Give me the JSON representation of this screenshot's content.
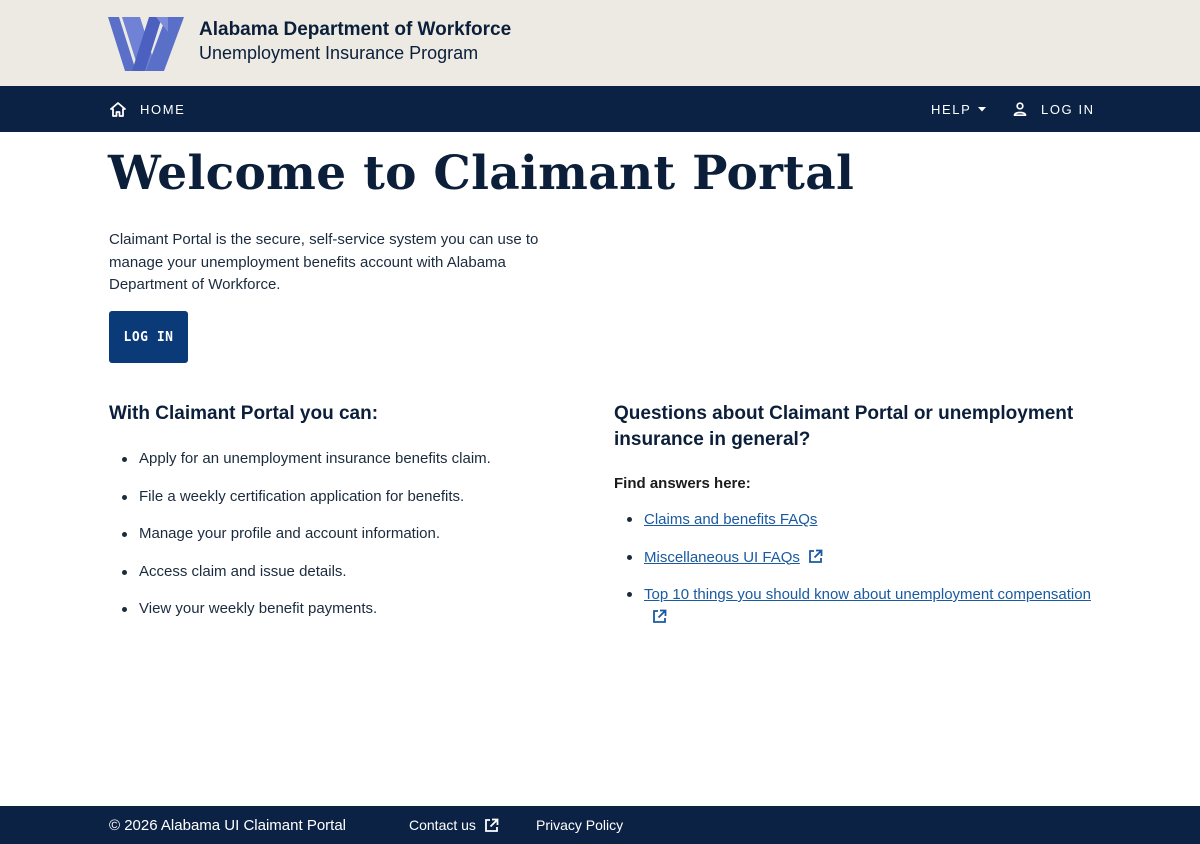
{
  "header": {
    "org_name": "Alabama Department of Workforce",
    "program_name": "Unemployment Insurance Program",
    "logo_icon": "adw-logo-icon",
    "logo_color": "#5a6fc8"
  },
  "nav": {
    "home_label": "HOME",
    "help_label": "HELP",
    "login_label": "LOG IN",
    "home_icon": "home-icon",
    "user_icon": "user-icon"
  },
  "main": {
    "title": "Welcome to Claimant Portal",
    "intro": "Claimant Portal is the secure, self-service system you can use to manage your unemployment benefits account with Alabama Department of Workforce.",
    "login_button": "LOG IN"
  },
  "features": {
    "heading": "With Claimant Portal you can:",
    "items": [
      "Apply for an unemployment insurance benefits claim.",
      "File a weekly certification application for benefits.",
      "Manage your profile and account information.",
      "Access claim and issue details.",
      "View your weekly benefit payments."
    ]
  },
  "questions": {
    "heading": "Questions about Claimant Portal or unemployment insurance in general?",
    "find_answers": "Find answers here:",
    "links": [
      "Claims and benefits FAQs",
      "Miscellaneous UI FAQs",
      "Top 10 things you should know about unemployment compensation"
    ]
  },
  "footer": {
    "copyright": "© 2026  Alabama UI Claimant Portal",
    "contact": "Contact us",
    "privacy": "Privacy Policy"
  },
  "colors": {
    "header_bg": "#eceae3",
    "nav_bg": "#0b2244",
    "button_bg": "#0a3a78",
    "link": "#1a5aa0"
  }
}
